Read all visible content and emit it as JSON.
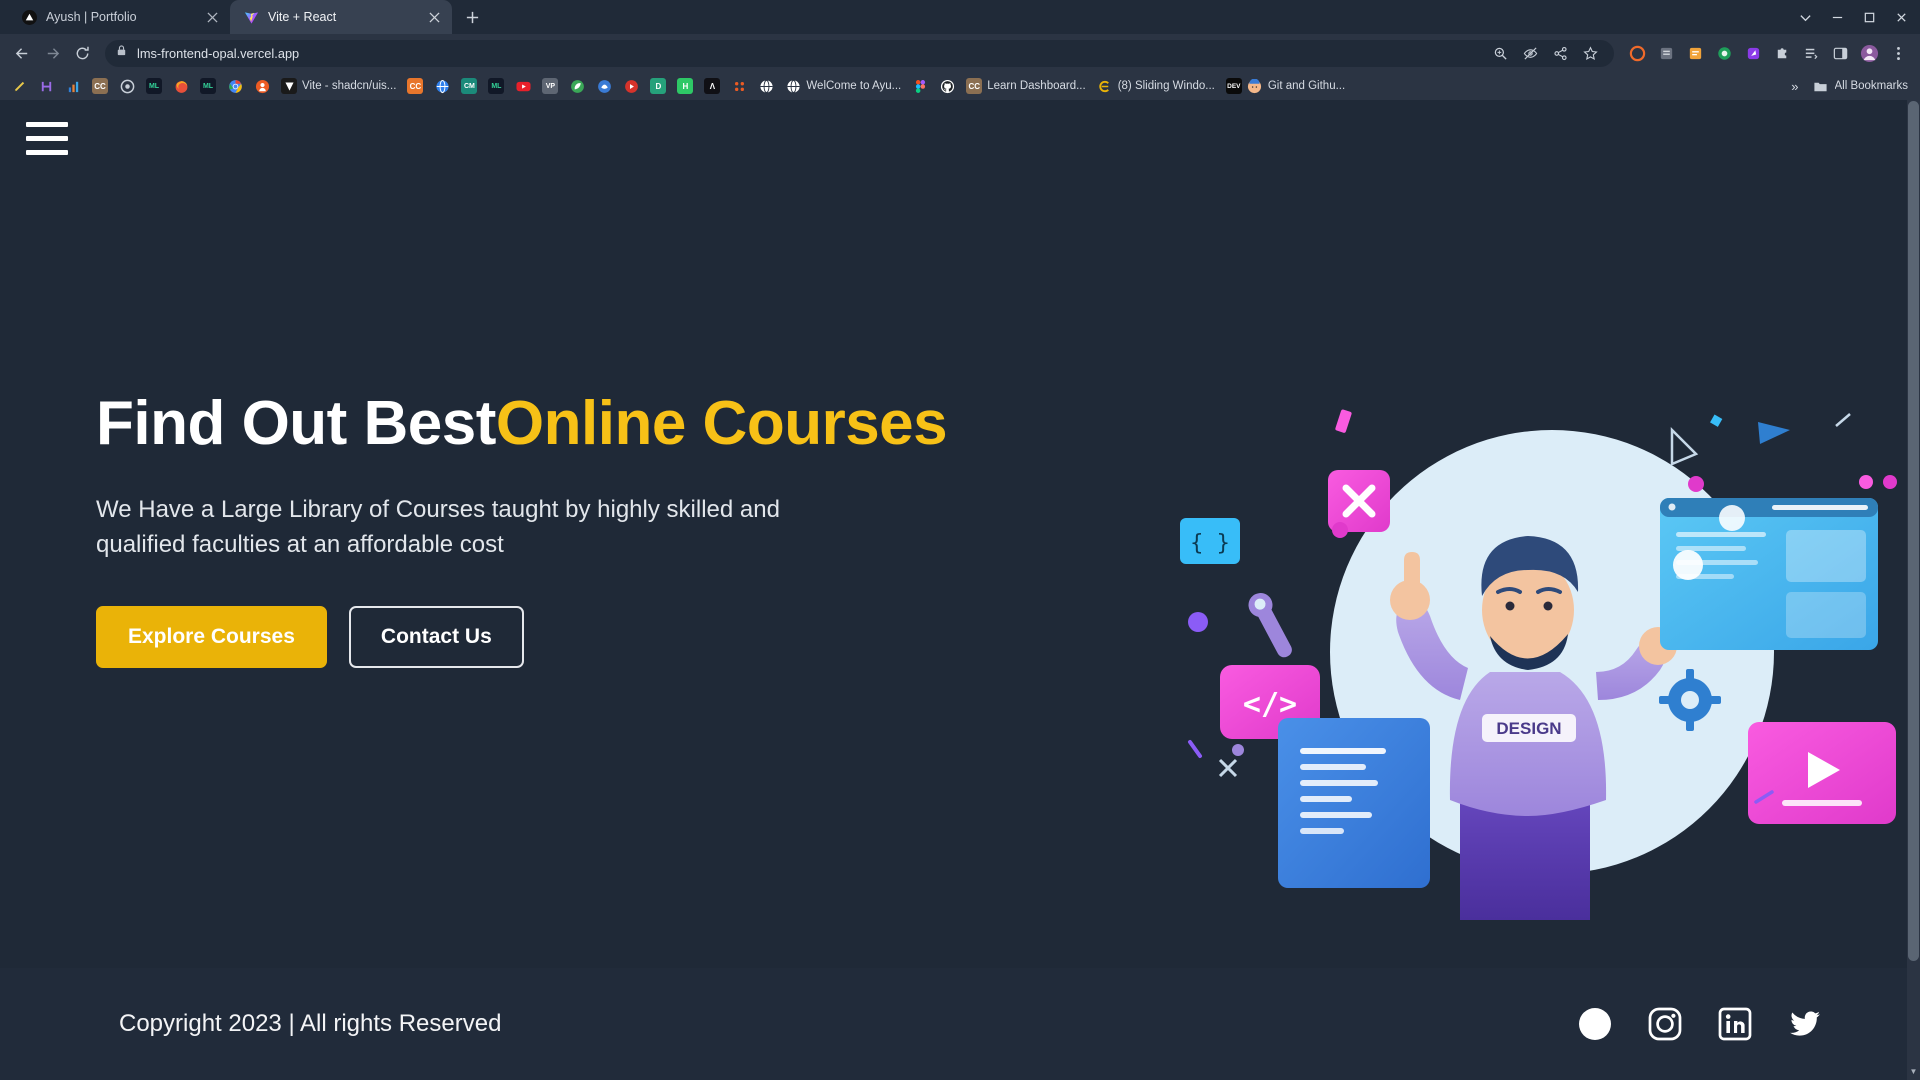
{
  "browser": {
    "tabs": [
      {
        "title": "Ayush | Portfolio",
        "favicon": "triangle-dark-icon",
        "active": false
      },
      {
        "title": "Vite + React",
        "favicon": "vite-icon",
        "active": true
      }
    ],
    "new_tab_label": "+",
    "window_controls": {
      "minimize": "–",
      "maximize": "❐",
      "close": "✕",
      "tab_search": "⌄"
    },
    "nav": {
      "back": "←",
      "forward": "→",
      "reload": "⟳",
      "lock_icon": "lock-icon",
      "url": "lms-frontend-opal.vercel.app",
      "zoom_icon": "zoom-magnifier-icon",
      "tracking_icon": "eye-slash-icon",
      "share_icon": "share-icon",
      "bookmark_icon": "star-icon",
      "profile_icon": "profile-avatar-icon",
      "menu_icon": "three-dot-menu-icon"
    },
    "bookmarks": {
      "items": [
        {
          "label": "",
          "icon": "pen-icon",
          "color": "#2B3443"
        },
        {
          "label": "",
          "icon": "purple-h-icon",
          "color": "#2B3443"
        },
        {
          "label": "",
          "icon": "bars-icon",
          "color": "#2B3443"
        },
        {
          "label": "",
          "icon": "cc-brown-icon",
          "color": "#8B6F52"
        },
        {
          "label": "",
          "icon": "gray-circle-icon",
          "color": "#3F4654"
        },
        {
          "label": "",
          "icon": "ml-green-icon",
          "color": "#111827"
        },
        {
          "label": "",
          "icon": "firefox-icon",
          "color": "#2B3443"
        },
        {
          "label": "",
          "icon": "ml-green2-icon",
          "color": "#111827"
        },
        {
          "label": "",
          "icon": "chrome-icon",
          "color": "#2B3443"
        },
        {
          "label": "",
          "icon": "orange-circle-icon",
          "color": "#EC5B23"
        },
        {
          "label": "Vite - shadcn/uis...",
          "icon": "vite-dark-icon",
          "color": "#1A1A1A"
        },
        {
          "label": "",
          "icon": "cc-orange-icon",
          "color": "#E8762C"
        },
        {
          "label": "",
          "icon": "globe-blue-icon",
          "color": "#2B3443"
        },
        {
          "label": "",
          "icon": "cm-teal-icon",
          "color": "#1B8A7A"
        },
        {
          "label": "",
          "icon": "ml-green3-icon",
          "color": "#111827"
        },
        {
          "label": "",
          "icon": "youtube-icon",
          "color": "#E8202A"
        },
        {
          "label": "",
          "icon": "vp-gray-icon",
          "color": "#5E6673"
        },
        {
          "label": "",
          "icon": "green-leaf-icon",
          "color": "#3AA757"
        },
        {
          "label": "",
          "icon": "blue-swirl-icon",
          "color": "#3A7BD5"
        },
        {
          "label": "",
          "icon": "yt-music-icon",
          "color": "#D6332B"
        },
        {
          "label": "",
          "icon": "d-green-icon",
          "color": "#26A17B"
        },
        {
          "label": "",
          "icon": "hackerrank-icon",
          "color": "#2EC866"
        },
        {
          "label": "",
          "icon": "angular-dark-icon",
          "color": "#101015"
        },
        {
          "label": "",
          "icon": "gray-dot-icon",
          "color": "#4B5563"
        },
        {
          "label": "",
          "icon": "figma-icon",
          "color": "#2B3443"
        },
        {
          "label": "WelCome to Ayu...",
          "icon": "globe-white-icon",
          "color": "#2B3443"
        },
        {
          "label": "",
          "icon": "figma2-icon",
          "color": "#2B3443"
        },
        {
          "label": "",
          "icon": "github-icon",
          "color": "#2B3443"
        },
        {
          "label": "Learn Dashboard...",
          "icon": "cc-brown2-icon",
          "color": "#8B6F52"
        },
        {
          "label": "(8) Sliding Windo...",
          "icon": "yellow-c-icon",
          "color": "#2B3443"
        },
        {
          "label": "Git and Githu...",
          "icon": "dev-icon",
          "color": "#0A0A0A"
        }
      ],
      "overflow_label": "»",
      "all_bookmarks_label": "All Bookmarks",
      "all_bookmarks_icon": "folder-icon"
    }
  },
  "page": {
    "menu_icon": "hamburger-menu-icon",
    "hero": {
      "title_plain": "Find Out Best",
      "title_accent": "Online Courses",
      "subtitle": "We Have a Large Library of Courses taught by highly skilled and qualified faculties at an affordable cost",
      "primary_button": "Explore Courses",
      "secondary_button": "Contact Us",
      "illustration": "developer-hero-illustration",
      "illustration_badge": "DESIGN",
      "illustration_code_tag": "</>",
      "illustration_braces": "{ }"
    },
    "footer": {
      "copyright": "Copyright 2023 | All rights Reserved",
      "socials": [
        {
          "name": "facebook-icon",
          "label": "Facebook"
        },
        {
          "name": "instagram-icon",
          "label": "Instagram"
        },
        {
          "name": "linkedin-icon",
          "label": "LinkedIn"
        },
        {
          "name": "twitter-icon",
          "label": "Twitter"
        }
      ]
    },
    "colors": {
      "background": "#1F2937",
      "footer_background": "#212B3A",
      "accent_yellow": "#F7C117",
      "button_yellow": "#EAB308",
      "text_white": "#FFFFFF"
    }
  }
}
